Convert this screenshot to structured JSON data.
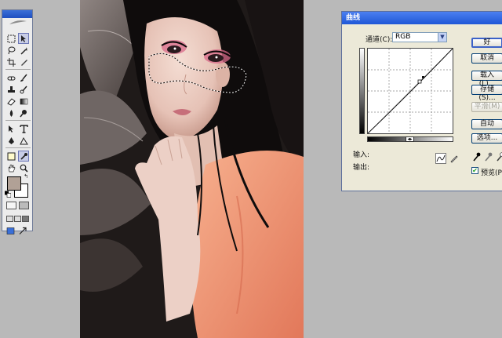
{
  "curves_dialog": {
    "title": "曲线",
    "channel_label": "通道(C):",
    "channel_value": "RGB",
    "buttons": {
      "ok": "好",
      "cancel": "取消",
      "load": "载入(L)...",
      "save": "存储(S)...",
      "smooth": "平滑(M)",
      "auto": "自动",
      "options": "选项..."
    },
    "input_label": "输入:",
    "output_label": "输出:",
    "preview_label": "预览(P)",
    "preview_checked": true
  },
  "toolbox": {
    "foreground_color": "#b1a196",
    "background_color": "#ffffff"
  },
  "colors": {
    "titlebar": "#2a5fdc",
    "dialog_bg": "#ece9d8",
    "workspace": "#b9b9b9",
    "selected_tool": "#c8cde6"
  }
}
